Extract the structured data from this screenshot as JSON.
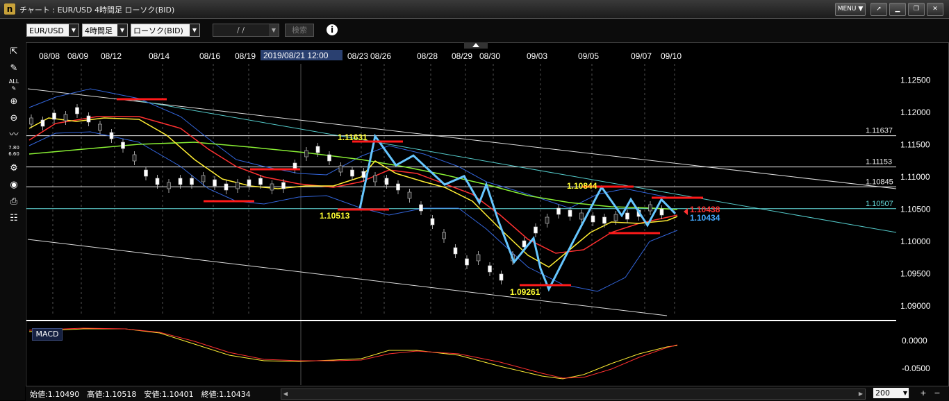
{
  "window": {
    "title": "チャート : EUR/USD 4時間足 ローソク(BID)",
    "menu_label": "MENU ▼",
    "logo": "n"
  },
  "toolbar": {
    "pair": "EUR/USD",
    "timeframe": "4時間足",
    "chart_type": "ローソク(BID)",
    "date_value": "/ /",
    "search_label": "検索",
    "info_icon": "i"
  },
  "tools": [
    "cursor-icon",
    "pencil-icon",
    "all-draw-icon",
    "zoom-in-icon",
    "zoom-out-icon",
    "indicator-icon",
    "price-table-icon",
    "settings-icon",
    "eye-icon",
    "print-icon",
    "list-icon"
  ],
  "chart_data": {
    "type": "line",
    "instrument": "EUR/USD",
    "x_tick_labels": [
      "08/08",
      "08/09",
      "08/12",
      "08/14",
      "08/16",
      "08/19",
      "08/23",
      "08/26",
      "08/28",
      "08/29",
      "08/30",
      "09/03",
      "09/05",
      "09/07",
      "09/10"
    ],
    "crosshair_label": "2019/08/21 12:00",
    "y_tick_labels": [
      "1.12500",
      "1.12000",
      "1.11500",
      "1.11000",
      "1.10500",
      "1.10000",
      "1.09500",
      "1.09000"
    ],
    "ylim": [
      1.0885,
      1.1275
    ],
    "horizontal_levels": [
      "1.11637",
      "1.11153",
      "1.10845",
      "1.10507"
    ],
    "annotations": [
      "1.11631",
      "1.10513",
      "1.10844",
      "1.09261"
    ],
    "current_price_labels": [
      "1.10438",
      "1.10434"
    ],
    "zigzag_series": [
      {
        "bar": 0,
        "y": 1.1051
      },
      {
        "bar": 1,
        "y": 1.1163
      },
      {
        "bar": 2,
        "y": 1.1118
      },
      {
        "bar": 3,
        "y": 1.1133
      },
      {
        "bar": 4,
        "y": 1.1088
      },
      {
        "bar": 5,
        "y": 1.1101
      },
      {
        "bar": 6,
        "y": 1.106
      },
      {
        "bar": 7,
        "y": 1.1088
      },
      {
        "bar": 8,
        "y": 1.103
      },
      {
        "bar": 9,
        "y": 1.0968
      },
      {
        "bar": 10,
        "y": 1.1005
      },
      {
        "bar": 11,
        "y": 1.0958
      },
      {
        "bar": 12,
        "y": 1.0926
      },
      {
        "bar": 13,
        "y": 1.1
      },
      {
        "bar": 14,
        "y": 1.1084
      },
      {
        "bar": 15,
        "y": 1.104
      },
      {
        "bar": 16,
        "y": 1.1065
      },
      {
        "bar": 17,
        "y": 1.1025
      },
      {
        "bar": 18,
        "y": 1.1065
      },
      {
        "bar": 19,
        "y": 1.1043
      }
    ],
    "macd": {
      "label": "MACD",
      "y_tick_labels": [
        "0.0000",
        "-0.0500"
      ]
    }
  },
  "status": {
    "ohlc": "始値:1.10490　高値:1.10518　安値:1.10401　終値:1.10434",
    "zoom": "200"
  },
  "colors": {
    "price_red": "#ff3333",
    "price_blue": "#44aaff",
    "zigzag": "#66c6ff",
    "ma_yellow": "#ffee33",
    "ma_red": "#ff3030",
    "ma_green": "#88ee33",
    "bollinger": "#3366dd",
    "level_marker": "#ff1a1a"
  }
}
